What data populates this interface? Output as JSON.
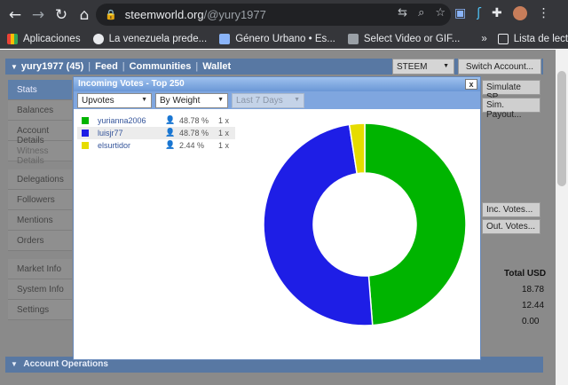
{
  "browser": {
    "url_domain": "steemworld.org",
    "url_path": "/@yury1977",
    "bookmarks": [
      {
        "label": "Aplicaciones",
        "color": "#4285f4"
      },
      {
        "label": "La venezuela prede...",
        "color": "#e8eaed"
      },
      {
        "label": "Género Urbano • Es...",
        "color": "#8ab4f8"
      },
      {
        "label": "Select Video or GIF...",
        "color": "#9aa0a6"
      }
    ],
    "more_bookmarks": "»",
    "reading_list": "Lista de lectura"
  },
  "topnav": {
    "user": "yury1977 (45)",
    "feed": "Feed",
    "communities": "Communities",
    "wallet": "Wallet",
    "currency_select": "STEEM",
    "switch_account": "Switch Account..."
  },
  "sidebar": {
    "group1": [
      "Stats",
      "Balances",
      "Account Details",
      "Witness Details"
    ],
    "group2": [
      "Delegations",
      "Followers",
      "Mentions",
      "Orders"
    ],
    "group3": [
      "Market Info",
      "System Info",
      "Settings"
    ]
  },
  "right_panel": {
    "simulate_sp": "Simulate SP...",
    "sim_payout": "Sim. Payout...",
    "inc_votes": "Inc. Votes...",
    "out_votes": "Out. Votes...",
    "total_usd": "Total USD",
    "values": [
      "18.78",
      "12.44",
      "0.00"
    ]
  },
  "account_ops": "Account Operations",
  "modal": {
    "title": "Incoming Votes - Top 250",
    "close": "x",
    "type_select": "Upvotes",
    "sort_select": "By Weight",
    "period_select": "Last 7 Days",
    "voters": [
      {
        "name": "yurianna2006",
        "pct": "48.78 %",
        "count": "1 x",
        "color": "#00b400"
      },
      {
        "name": "luisjr77",
        "pct": "48.78 %",
        "count": "1 x",
        "color": "#1e1ee6"
      },
      {
        "name": "elsurtidor",
        "pct": "2.44 %",
        "count": "1 x",
        "color": "#e6dc00"
      }
    ]
  },
  "chart_data": {
    "type": "pie",
    "categories": [
      "yurianna2006",
      "luisjr77",
      "elsurtidor"
    ],
    "values": [
      48.78,
      48.78,
      2.44
    ],
    "colors": [
      "#00b400",
      "#1e1ee6",
      "#e6dc00"
    ],
    "donut": true
  }
}
